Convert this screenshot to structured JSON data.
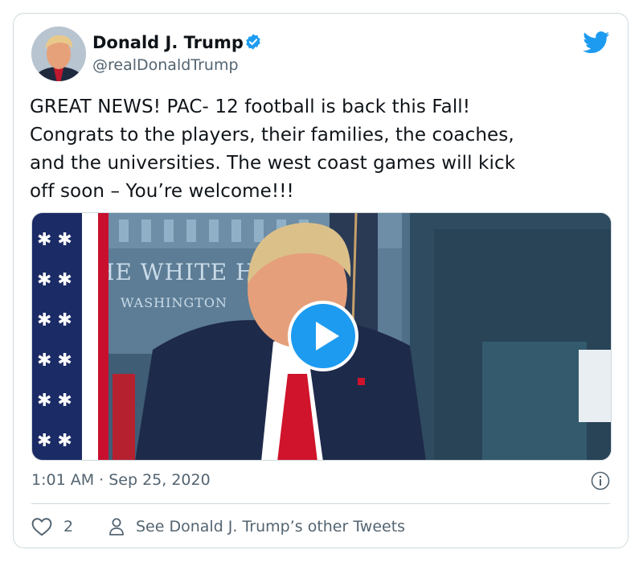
{
  "author": {
    "name": "Donald J. Trump",
    "handle": "@realDonaldTrump",
    "verified": true
  },
  "tweet": {
    "text": "GREAT NEWS! PAC- 12 football is back this Fall!\nCongrats to the players, their families, the coaches,\nand the universities. The west coast games will kick\noff soon – You’re welcome!!!"
  },
  "media": {
    "type": "video",
    "sign_line1": "HE WHITE HO",
    "sign_line2": "WASHINGTON"
  },
  "meta": {
    "timestamp": "1:01 AM · Sep 25, 2020"
  },
  "actions": {
    "like_count": "2",
    "other_tweets_label": "See Donald J. Trump’s other Tweets"
  },
  "colors": {
    "accent": "#1d9bf0",
    "secondary_text": "#536471",
    "border": "#cfd9de"
  },
  "icons": [
    "verified-badge-icon",
    "twitter-bird-icon",
    "play-icon",
    "info-icon",
    "heart-icon",
    "person-icon"
  ]
}
